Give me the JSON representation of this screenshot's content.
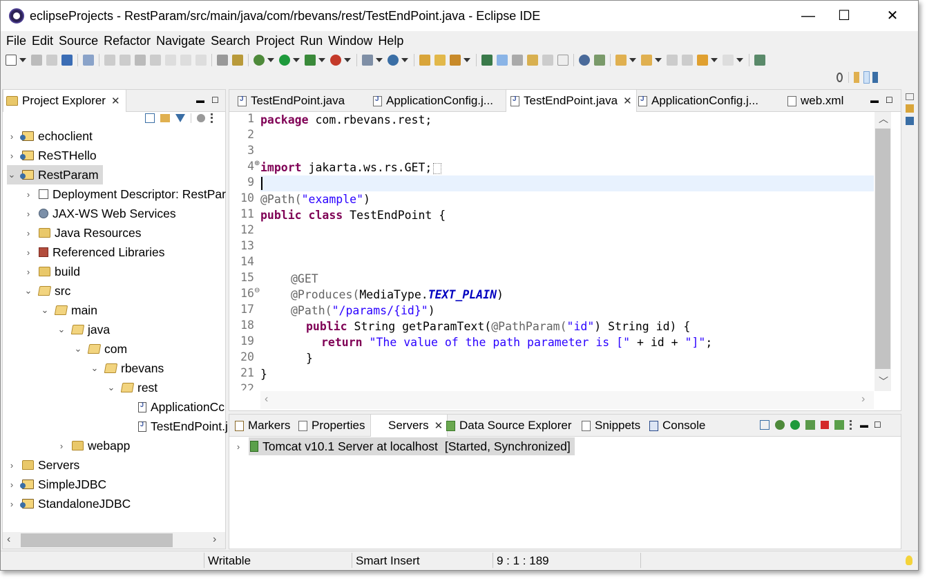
{
  "window": {
    "title": "eclipseProjects - RestParam/src/main/java/com/rbevans/rest/TestEndPoint.java - Eclipse IDE",
    "controls": {
      "minimize": "—",
      "maximize": "☐",
      "close": "✕"
    }
  },
  "menu": [
    "File",
    "Edit",
    "Source",
    "Refactor",
    "Navigate",
    "Search",
    "Project",
    "Run",
    "Window",
    "Help"
  ],
  "project_explorer": {
    "title": "Project Explorer",
    "items": [
      {
        "label": "echoclient",
        "twisty": "›"
      },
      {
        "label": "ReSTHello",
        "twisty": "›"
      },
      {
        "label": "RestParam",
        "twisty": "⌄"
      },
      {
        "label": "Deployment Descriptor: RestPar",
        "twisty": "›"
      },
      {
        "label": "JAX-WS Web Services",
        "twisty": "›"
      },
      {
        "label": "Java Resources",
        "twisty": "›"
      },
      {
        "label": "Referenced Libraries",
        "twisty": "›"
      },
      {
        "label": "build",
        "twisty": "›"
      },
      {
        "label": "src",
        "twisty": "⌄"
      },
      {
        "label": "main",
        "twisty": "⌄"
      },
      {
        "label": "java",
        "twisty": "⌄"
      },
      {
        "label": "com",
        "twisty": "⌄"
      },
      {
        "label": "rbevans",
        "twisty": "⌄"
      },
      {
        "label": "rest",
        "twisty": "⌄"
      },
      {
        "label": "ApplicationCc",
        "twisty": ""
      },
      {
        "label": "TestEndPoint.j",
        "twisty": ""
      },
      {
        "label": "webapp",
        "twisty": "›"
      },
      {
        "label": "Servers",
        "twisty": "›"
      },
      {
        "label": "SimpleJDBC",
        "twisty": "›"
      },
      {
        "label": "StandaloneJDBC",
        "twisty": "›"
      }
    ]
  },
  "editor_tabs": [
    {
      "label": "TestEndPoint.java"
    },
    {
      "label": "ApplicationConfig.j..."
    },
    {
      "label": "TestEndPoint.java"
    },
    {
      "label": "ApplicationConfig.j..."
    },
    {
      "label": "web.xml"
    }
  ],
  "editor": {
    "line_numbers": [
      "1",
      "2",
      "3",
      "4",
      "9",
      "10",
      "11",
      "12",
      "13",
      "14",
      "15",
      "16",
      "17",
      "18",
      "19",
      "20",
      "21",
      "22"
    ],
    "code": {
      "l1_kw": "package",
      "l1_rest": " com.rbevans.rest;",
      "l4_kw": "import",
      "l4_rest": " jakarta.ws.rs.GET;",
      "l10_ann": "@Path(",
      "l10_str": "\"example\"",
      "l10_end": ")",
      "l11_kw": "public class",
      "l11_rest": " TestEndPoint {",
      "l15_ann": "@GET",
      "l16_ann": "@Produces(",
      "l16_mid": "MediaType.",
      "l16_stat": "TEXT_PLAIN",
      "l16_end": ")",
      "l17_ann": "@Path(",
      "l17_str": "\"/params/{id}\"",
      "l17_end": ")",
      "l18_kw": "public",
      "l18_mid": " String getParamText(",
      "l18_ann": "@PathParam(",
      "l18_str": "\"id\"",
      "l18_end": ") String id) {",
      "l19_kw": "return",
      "l19_str1": " \"The value of the path parameter is [\"",
      "l19_mid": " + id + ",
      "l19_str2": "\"]\"",
      "l19_end": ";",
      "l20": "}",
      "l21": "}"
    }
  },
  "bottom_tabs": [
    {
      "label": "Markers"
    },
    {
      "label": "Properties"
    },
    {
      "label": "Servers"
    },
    {
      "label": "Data Source Explorer"
    },
    {
      "label": "Snippets"
    },
    {
      "label": "Console"
    }
  ],
  "servers": {
    "row_label": "Tomcat v10.1 Server at localhost",
    "row_state": "[Started, Synchronized]"
  },
  "status": {
    "writable": "Writable",
    "insert_mode": "Smart Insert",
    "position": "9 : 1 : 189"
  }
}
